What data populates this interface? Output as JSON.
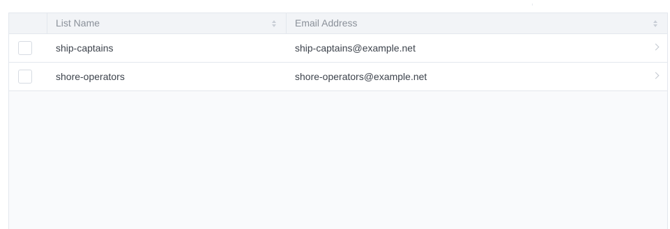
{
  "table": {
    "columns": [
      {
        "label": "",
        "sortable": false
      },
      {
        "label": "List Name",
        "sortable": true
      },
      {
        "label": "Email Address",
        "sortable": true
      }
    ],
    "rows": [
      {
        "name": "ship-captains",
        "email": "ship-captains@example.net",
        "checked": false
      },
      {
        "name": "shore-operators",
        "email": "shore-operators@example.net",
        "checked": false
      }
    ]
  },
  "icons": {
    "sort": "sort-icon",
    "row_open": "chevron-right-icon"
  },
  "colors": {
    "border": "#e3e7ed",
    "header_bg": "#f2f4f7",
    "empty_bg": "#f9fafc",
    "header_text": "#8a9099",
    "row_text": "#3d434c"
  }
}
